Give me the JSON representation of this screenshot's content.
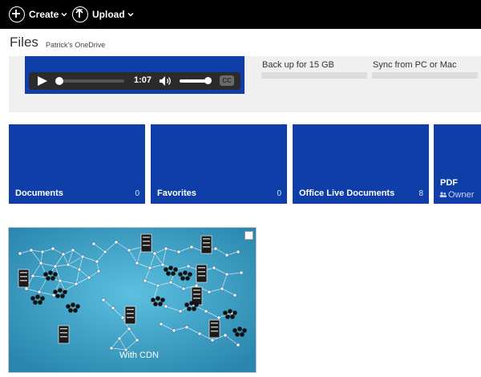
{
  "toolbar": {
    "create_label": "Create",
    "upload_label": "Upload"
  },
  "header": {
    "title": "Files",
    "breadcrumb": "Patrick's OneDrive"
  },
  "banner": {
    "video": {
      "time": "1:07",
      "progress": 0.05,
      "volume": 0.85,
      "cc_label": "CC"
    },
    "offers": [
      {
        "label": "Back up for 15 GB"
      },
      {
        "label": "Sync from PC or Mac"
      }
    ]
  },
  "tiles": [
    {
      "name": "Documents",
      "count": "0"
    },
    {
      "name": "Favorites",
      "count": "0"
    },
    {
      "name": "Office Live Documents",
      "count": "8"
    },
    {
      "name": "PDF",
      "sharing": "Owner"
    }
  ],
  "image_tile": {
    "caption": "With CDN"
  },
  "colors": {
    "tile_blue": "#0f3ea8",
    "topbar": "#000000",
    "banner_gray": "#f0f0f0"
  }
}
